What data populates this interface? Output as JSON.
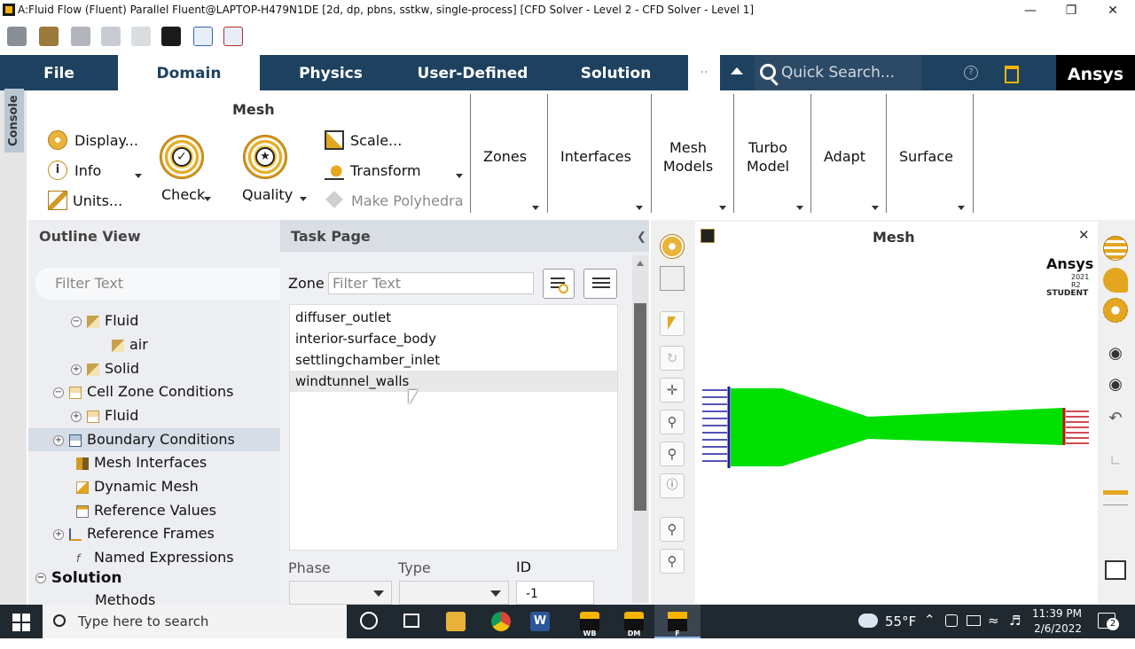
{
  "window": {
    "title": "A:Fluid Flow (Fluent) Parallel Fluent@LAPTOP-H479N1DE  [2d, dp, pbns, sstkw, single-process] [CFD Solver - Level 2 - CFD Solver - Level 1]"
  },
  "ribbon_tabs": [
    "File",
    "Domain",
    "Physics",
    "User-Defined",
    "Solution"
  ],
  "search": {
    "placeholder": "Quick Search..."
  },
  "brand": "Ansys",
  "console_label": "Console",
  "mesh_group": {
    "title": "Mesh",
    "display": "Display...",
    "info": "Info",
    "units": "Units...",
    "check": "Check",
    "quality": "Quality",
    "scale": "Scale...",
    "transform": "Transform",
    "make_polyhedra": "Make Polyhedra"
  },
  "ribbon_groups": {
    "zones": "Zones",
    "interfaces": "Interfaces",
    "mesh_models_1": "Mesh",
    "mesh_models_2": "Models",
    "turbo_1": "Turbo",
    "turbo_2": "Model",
    "adapt": "Adapt",
    "surface": "Surface"
  },
  "outline": {
    "title": "Outline View",
    "filter_placeholder": "Filter Text",
    "items": [
      "Fluid",
      "air",
      "Solid",
      "Cell Zone Conditions",
      "Fluid",
      "Boundary Conditions",
      "Mesh Interfaces",
      "Dynamic Mesh",
      "Reference Values",
      "Reference Frames",
      "Named Expressions",
      "Solution",
      "Methods"
    ]
  },
  "task": {
    "title": "Task Page",
    "zone_label": "Zone",
    "filter_placeholder": "Filter Text",
    "zones": [
      "diffuser_outlet",
      "interior-surface_body",
      "settlingchamber_inlet",
      "windtunnel_walls"
    ],
    "phase_label": "Phase",
    "type_label": "Type",
    "id_label": "ID",
    "id_value": "-1"
  },
  "graphics": {
    "title": "Mesh",
    "logo": "Ansys",
    "version": "2021 R2",
    "edition": "STUDENT"
  },
  "taskbar": {
    "search_placeholder": "Type here to search",
    "temperature": "55°F",
    "time": "11:39 PM",
    "date": "2/6/2022",
    "wb": "WB",
    "dm": "DM",
    "f": "F",
    "notifications": "2"
  },
  "colors": {
    "tab_bar": "#1e4160",
    "mesh_fill": "#00e000",
    "inlet": "#1a1aa0",
    "outlet": "#c0101a",
    "selected_row": "#d7dde6"
  }
}
